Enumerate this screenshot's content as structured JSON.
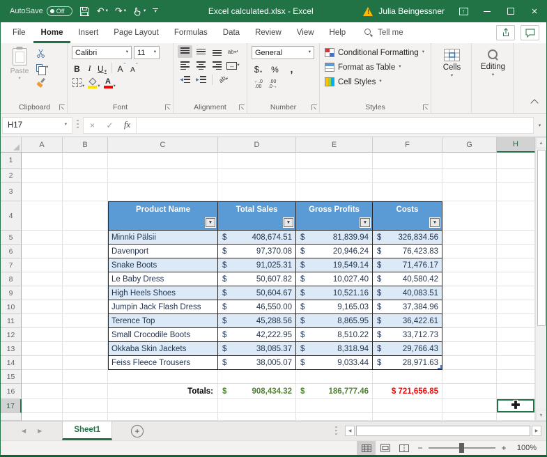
{
  "titlebar": {
    "autosave_label": "AutoSave",
    "autosave_state": "Off",
    "title": "Excel calculated.xlsx  -  Excel",
    "user_name": "Julia Beingessner"
  },
  "ribbon": {
    "tabs": [
      "File",
      "Home",
      "Insert",
      "Page Layout",
      "Formulas",
      "Data",
      "Review",
      "View",
      "Help"
    ],
    "active_tab": "Home",
    "tell_me": "Tell me",
    "clipboard": {
      "group_label": "Clipboard",
      "paste_label": "Paste"
    },
    "font": {
      "group_label": "Font",
      "font_name": "Calibri",
      "font_size": "11",
      "bold": "B",
      "italic": "I",
      "underline": "U",
      "grow": "A",
      "shrink": "A",
      "color_letter": "A"
    },
    "alignment": {
      "group_label": "Alignment"
    },
    "number": {
      "group_label": "Number",
      "format": "General",
      "currency": "$",
      "percent": "%",
      "comma": ","
    },
    "styles": {
      "group_label": "Styles",
      "items": [
        "Conditional Formatting",
        "Format as Table",
        "Cell Styles"
      ]
    },
    "cells": {
      "group_label": "Cells"
    },
    "editing": {
      "group_label": "Editing"
    }
  },
  "formula_bar": {
    "name_box": "H17",
    "fx_label": "fx",
    "formula_value": ""
  },
  "grid": {
    "columns": [
      "A",
      "B",
      "C",
      "D",
      "E",
      "F",
      "G",
      "H"
    ],
    "selected_column": "H",
    "row_numbers": [
      1,
      2,
      3,
      4,
      5,
      6,
      7,
      8,
      9,
      10,
      11,
      12,
      13,
      14,
      15,
      16,
      17
    ],
    "selected_row": 17,
    "selected_cell": "H17"
  },
  "table": {
    "currency": "$",
    "headers": [
      "Product Name",
      "Total Sales",
      "Gross Profits",
      "Costs"
    ],
    "rows": [
      {
        "name": "Minnki Pälsii",
        "sales": "408,674.51",
        "profits": "81,839.94",
        "costs": "326,834.56"
      },
      {
        "name": "Davenport",
        "sales": "97,370.08",
        "profits": "20,946.24",
        "costs": "76,423.83"
      },
      {
        "name": "Snake Boots",
        "sales": "91,025.31",
        "profits": "19,549.14",
        "costs": "71,476.17"
      },
      {
        "name": "Le Baby Dress",
        "sales": "50,607.82",
        "profits": "10,027.40",
        "costs": "40,580.42"
      },
      {
        "name": "High Heels Shoes",
        "sales": "50,604.67",
        "profits": "10,521.16",
        "costs": "40,083.51"
      },
      {
        "name": "Jumpin Jack Flash Dress",
        "sales": "46,550.00",
        "profits": "9,165.03",
        "costs": "37,384.96"
      },
      {
        "name": "Terence Top",
        "sales": "45,288.56",
        "profits": "8,865.95",
        "costs": "36,422.61"
      },
      {
        "name": "Small Crocodile Boots",
        "sales": "42,222.95",
        "profits": "8,510.22",
        "costs": "33,712.73"
      },
      {
        "name": "Okkaba Skin Jackets",
        "sales": "38,085.37",
        "profits": "8,318.94",
        "costs": "29,766.43"
      },
      {
        "name": "Feiss Fleece Trousers",
        "sales": "38,005.07",
        "profits": "9,033.44",
        "costs": "28,971.63"
      }
    ],
    "totals": {
      "label": "Totals:",
      "sales": "908,434.32",
      "profits": "186,777.46",
      "costs": "$ 721,656.85"
    }
  },
  "sheet_bar": {
    "active_sheet": "Sheet1"
  },
  "status_bar": {
    "zoom_level": "100%"
  },
  "icons": {
    "dropdown": "▾",
    "filter_arrow": "▼",
    "undo": "↶",
    "redo": "↷",
    "close": "×",
    "cancel": "×",
    "check": "✓",
    "up_arrow": "↑",
    "scroll_up": "▲",
    "scroll_down": "▼",
    "scroll_left": "◀",
    "scroll_right": "▶",
    "sheet_prev": "◀",
    "sheet_next": "▶",
    "add_sheet": "+",
    "caret_up": "ˆ",
    "caret_down": "ˇ",
    "wrap_text": "ab↵",
    "merge_arrows": "↔",
    "orientation": "ab",
    "inc_decimal": "←.0\n.00",
    "dec_decimal": ".00\n.0→",
    "zoom_out": "−",
    "zoom_in": "+"
  },
  "colors": {
    "excel_green": "#217346",
    "table_header_blue": "#5B9BD5",
    "band_blue": "#DCE9F6",
    "totals_green": "#548235",
    "totals_red": "#FE0000"
  }
}
